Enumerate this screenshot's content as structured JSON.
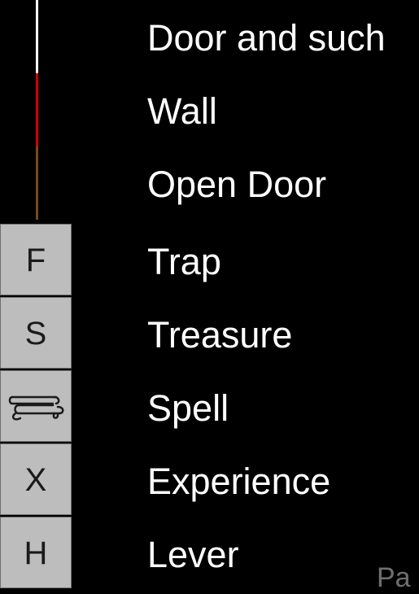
{
  "legend": {
    "items": [
      {
        "label": "Door and such",
        "symbol_type": "line",
        "symbol_color": "#ffffff"
      },
      {
        "label": "Wall",
        "symbol_type": "line",
        "symbol_color": "#d10000"
      },
      {
        "label": "Open Door",
        "symbol_type": "line",
        "symbol_color": "#7a4a16"
      },
      {
        "label": "Trap",
        "symbol_type": "tile",
        "symbol_text": "F"
      },
      {
        "label": "Treasure",
        "symbol_type": "tile",
        "symbol_text": "S"
      },
      {
        "label": "Spell",
        "symbol_type": "tile",
        "symbol_icon": "scroll-icon"
      },
      {
        "label": "Experience",
        "symbol_type": "tile",
        "symbol_text": "X"
      },
      {
        "label": "Lever",
        "symbol_type": "tile",
        "symbol_text": "H"
      }
    ]
  },
  "footer": {
    "partial_text": "Pa"
  },
  "colors": {
    "background": "#000000",
    "label_text": "#ffffff",
    "tile_fill": "#bdbdbd",
    "tile_text": "#1a1a1a"
  }
}
